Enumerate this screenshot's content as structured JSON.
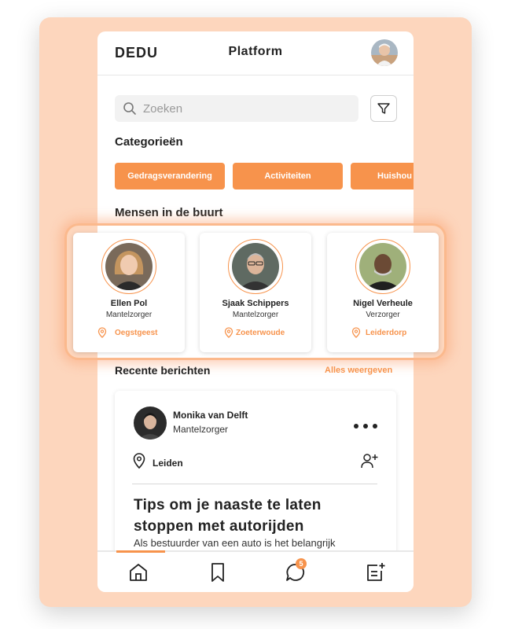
{
  "header": {
    "brand": "DEDU",
    "title": "Platform"
  },
  "search": {
    "placeholder": "Zoeken",
    "value": ""
  },
  "categories": {
    "title": "Categorieën",
    "items": [
      "Gedragsverandering",
      "Activiteiten",
      "Huishou"
    ]
  },
  "people": {
    "title": "Mensen in de buurt",
    "items": [
      {
        "name": "Ellen Pol",
        "role": "Mantelzorger",
        "location": "Oegstgeest"
      },
      {
        "name": "Sjaak Schippers",
        "role": "Mantelzorger",
        "location": "Zoeterwoude"
      },
      {
        "name": "Nigel Verheule",
        "role": "Verzorger",
        "location": "Leiderdorp"
      }
    ]
  },
  "recent": {
    "title": "Recente berichten",
    "see_all": "Alles weergeven",
    "post": {
      "author": "Monika van Delft",
      "role": "Mantelzorger",
      "location": "Leiden",
      "heading": "Tips om je naaste te laten stoppen met autorijden",
      "text": "Als bestuurder van een auto is het belangrijk"
    }
  },
  "nav": {
    "messages_badge": "5"
  },
  "colors": {
    "accent": "#f7934c",
    "backdrop": "#fdd6bd"
  },
  "icons": [
    "search-icon",
    "filter-icon",
    "location-pin-icon",
    "more-icon",
    "add-user-icon",
    "home-icon",
    "bookmark-icon",
    "chat-icon",
    "new-post-icon"
  ]
}
